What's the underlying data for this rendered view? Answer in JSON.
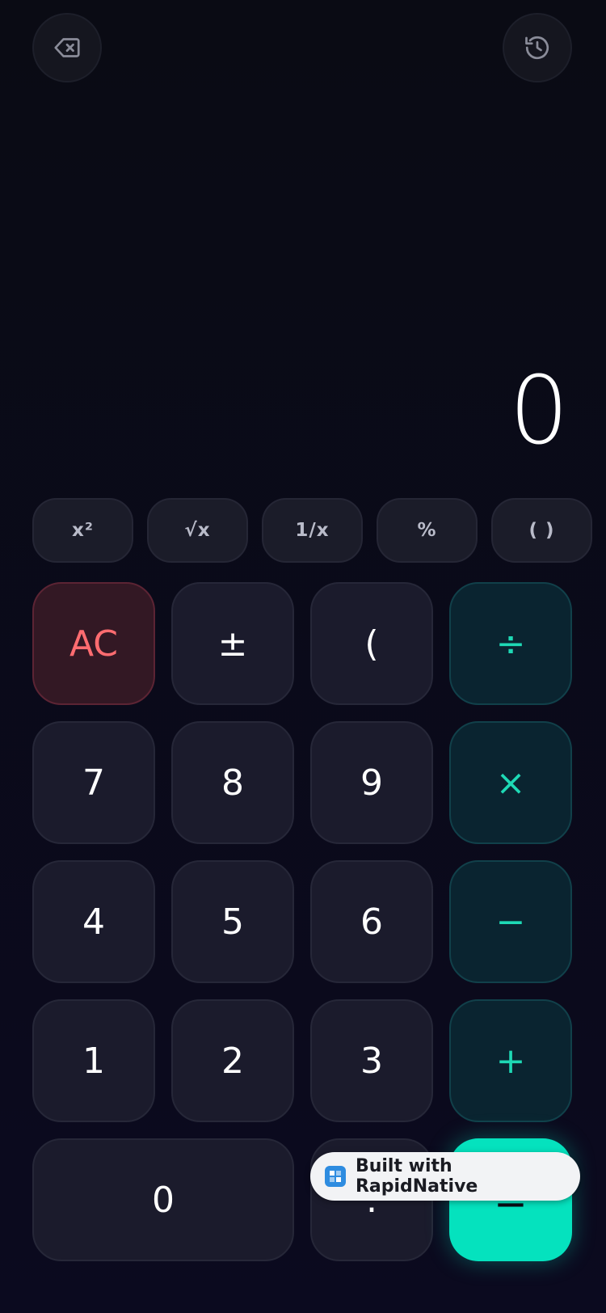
{
  "top_bar": {
    "backspace_icon": "backspace-icon",
    "history_icon": "history-icon"
  },
  "display": {
    "value": "0"
  },
  "scientific": [
    "x²",
    "√x",
    "1/x",
    "%",
    "( )"
  ],
  "keypad": {
    "row1": [
      "AC",
      "±",
      "(",
      "÷"
    ],
    "row2": [
      "7",
      "8",
      "9",
      "×"
    ],
    "row3": [
      "4",
      "5",
      "6",
      "−"
    ],
    "row4": [
      "1",
      "2",
      "3",
      "+"
    ],
    "row5": [
      "0",
      ".",
      "="
    ]
  },
  "badge": {
    "text": "Built with RapidNative"
  },
  "colors": {
    "accent": "#05e2be",
    "clear": "#ff6c70",
    "background": "#0a0b14"
  }
}
